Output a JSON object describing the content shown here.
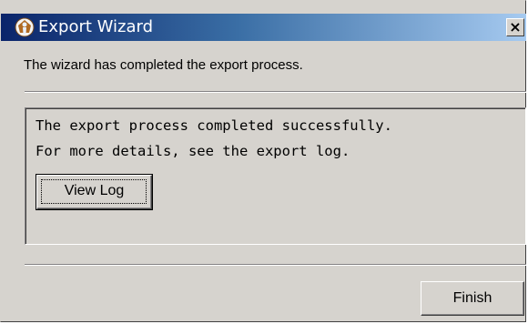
{
  "window": {
    "title": "Export Wizard",
    "close_glyph": "×"
  },
  "message": "The wizard has completed the export process.",
  "result": {
    "lines": [
      "The export process completed successfully.",
      "For more details, see the export log."
    ],
    "view_log_label": "View Log"
  },
  "footer": {
    "finish_label": "Finish"
  },
  "icons": {
    "app": "export-wizard-icon",
    "close": "close-icon"
  },
  "colors": {
    "titlebar_start": "#0a246a",
    "titlebar_end": "#a6caf0",
    "dialog_background": "#d6d3ce"
  }
}
